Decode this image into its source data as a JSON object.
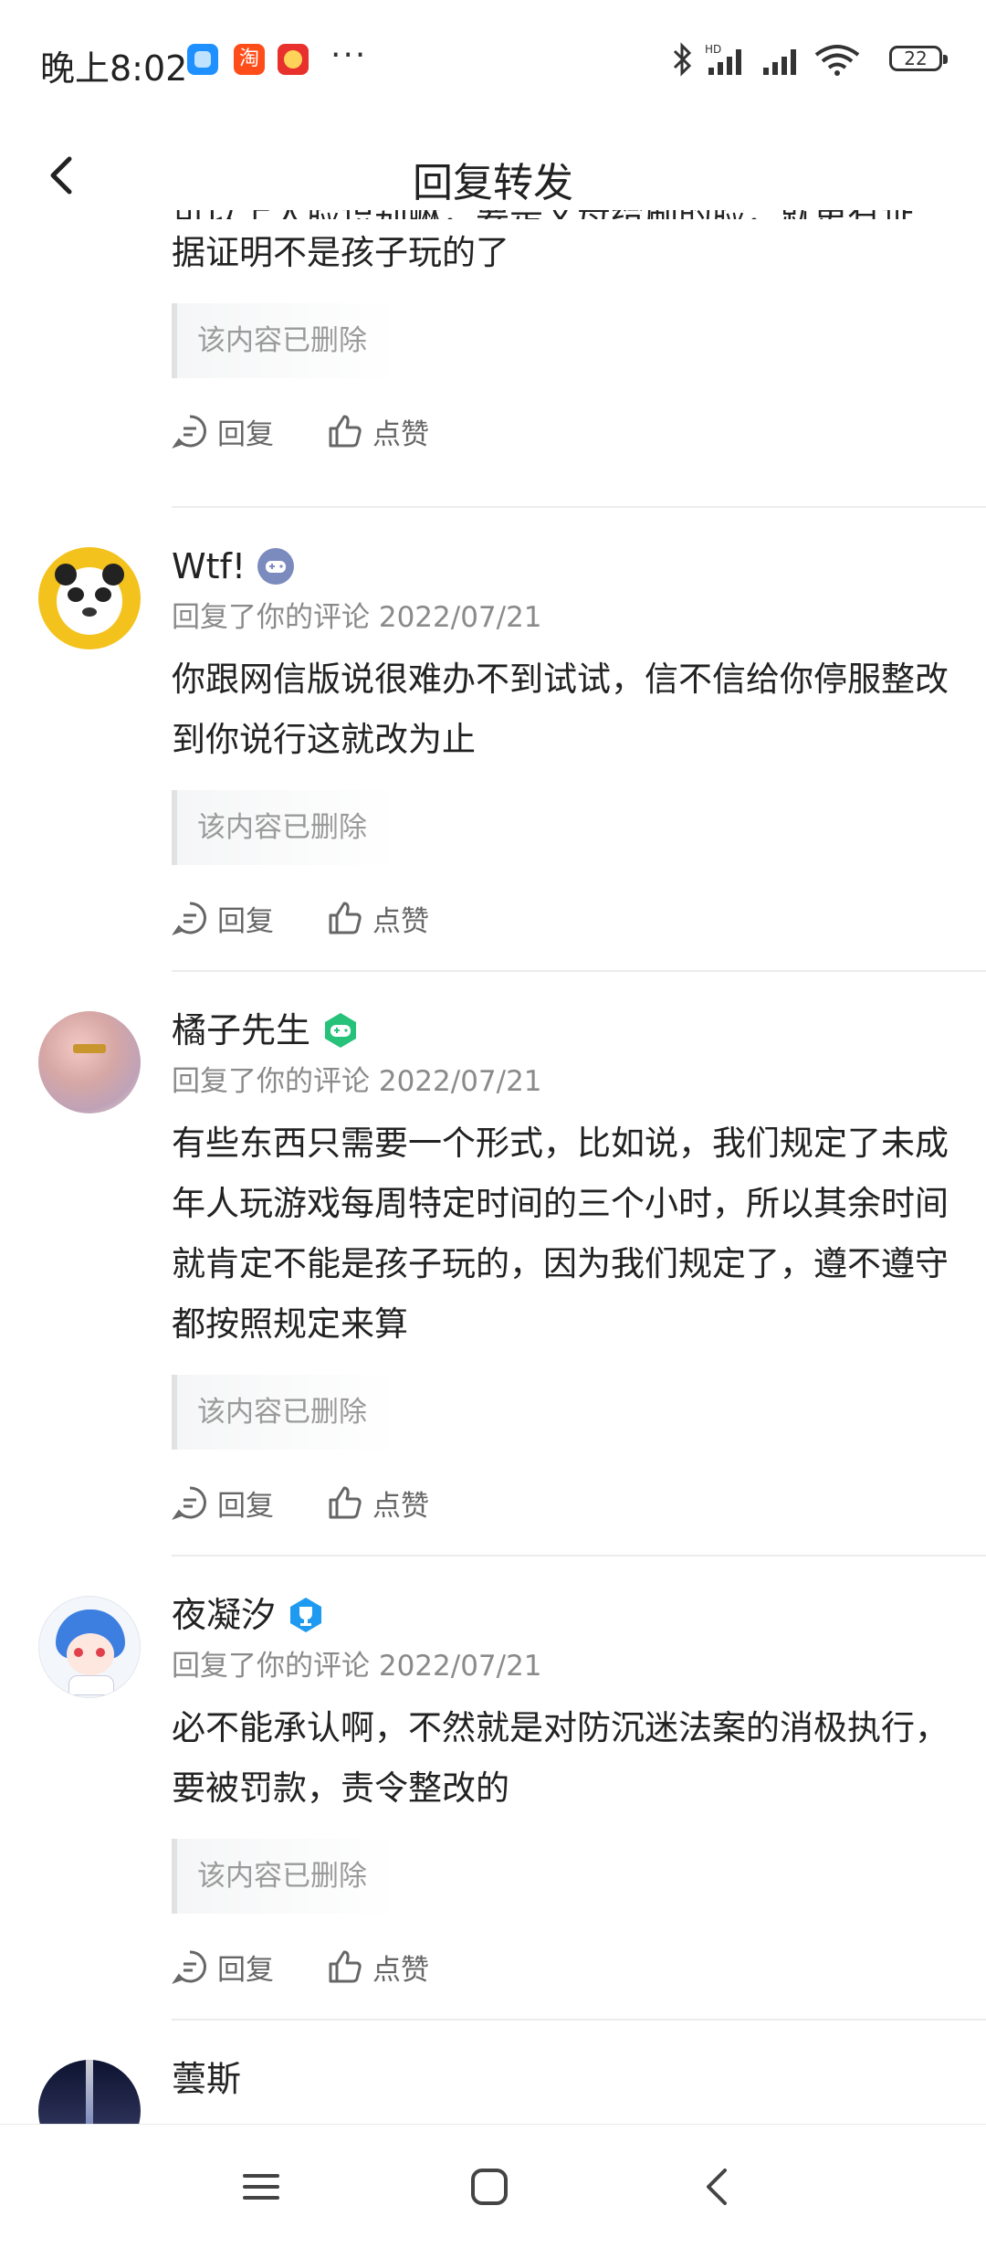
{
  "status_bar": {
    "time": "晚上8:02",
    "battery": "22",
    "app_icons": [
      "qq-browser-icon",
      "taobao-icon",
      "game-app-icon"
    ],
    "more": "···"
  },
  "header": {
    "title": "回复转发"
  },
  "comments": [
    {
      "text_partial_top": "可以上人脸识别嘛，要是父母给刷的脸，就更有证",
      "text_partial_bottom": "据证明不是孩子玩的了",
      "quote": "该内容已删除",
      "reply_label": "回复",
      "like_label": "点赞"
    },
    {
      "name": "Wtf!",
      "badge": "game-controller-badge-icon",
      "meta": "回复了你的评论 2022/07/21",
      "text": "你跟网信版说很难办不到试试，信不信给你停服整改到你说行这就改为止",
      "quote": "该内容已删除",
      "reply_label": "回复",
      "like_label": "点赞"
    },
    {
      "name": "橘子先生",
      "badge": "gamepad-badge-icon",
      "meta": "回复了你的评论 2022/07/21",
      "text": "有些东西只需要一个形式，比如说，我们规定了未成年人玩游戏每周特定时间的三个小时，所以其余时间就肯定不能是孩子玩的，因为我们规定了，遵不遵守都按照规定来算",
      "quote": "该内容已删除",
      "reply_label": "回复",
      "like_label": "点赞"
    },
    {
      "name": "夜凝汐",
      "badge": "trophy-badge-icon",
      "meta": "回复了你的评论 2022/07/21",
      "text": "必不能承认啊，不然就是对防沉迷法案的消极执行，要被罚款，责令整改的",
      "quote": "该内容已删除",
      "reply_label": "回复",
      "like_label": "点赞"
    },
    {
      "name": "蕓斯"
    }
  ],
  "colors": {
    "badge_blue_grey": "#7b8bbd",
    "badge_green": "#27c27a",
    "badge_blue": "#1e9bf0",
    "text_main": "#222222",
    "text_meta": "#8a8a8a"
  }
}
